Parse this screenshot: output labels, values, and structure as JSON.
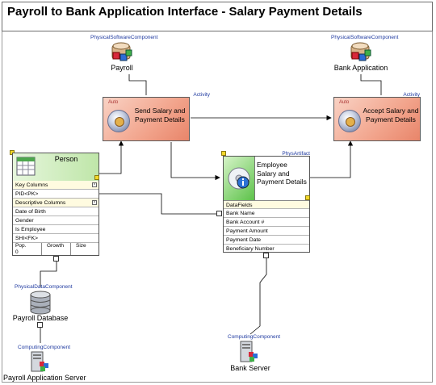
{
  "title": "Payroll to Bank Application Interface - Salary Payment Details",
  "stereotypes": {
    "physical_software": "PhysicalSoftwareComponent",
    "activity": "Activity",
    "phys_artifact": "PhysArtifact",
    "physical_data": "PhysicalDataComponent",
    "computing": "ComputingComponent",
    "auto": "Auto"
  },
  "components": {
    "payroll": "Payroll",
    "bank_application": "Bank Application",
    "payroll_database": "Payroll Database",
    "payroll_server": "Payroll Application Server",
    "bank_server": "Bank Server"
  },
  "activities": {
    "send": [
      "Send Salary and",
      "Payment Details"
    ],
    "accept": [
      "Accept Salary and",
      "Payment Details"
    ]
  },
  "artifact": {
    "name": [
      "Employee",
      "Salary and",
      "Payment Details"
    ],
    "section": "DataFields",
    "fields": [
      "Bank Name",
      "Bank Account #",
      "Payment Amount",
      "Payment Date",
      "Beneficiary Number"
    ]
  },
  "person": {
    "name": "Person",
    "key_section": "Key Columns",
    "key_rows": [
      "PID<PK>"
    ],
    "desc_section": "Descriptive Columns",
    "desc_rows": [
      "Date of Birth",
      "Gender",
      "Is Employee",
      "SHI<FK>"
    ],
    "footer": {
      "pop_label": "Pop.",
      "pop_value": "0",
      "growth_label": "Growth",
      "size_label": "Size"
    }
  },
  "colors": {
    "activity_fill": "#f2a48c",
    "entity_header": "#bfe6a9",
    "stereotype_text": "#1f3aa0"
  }
}
